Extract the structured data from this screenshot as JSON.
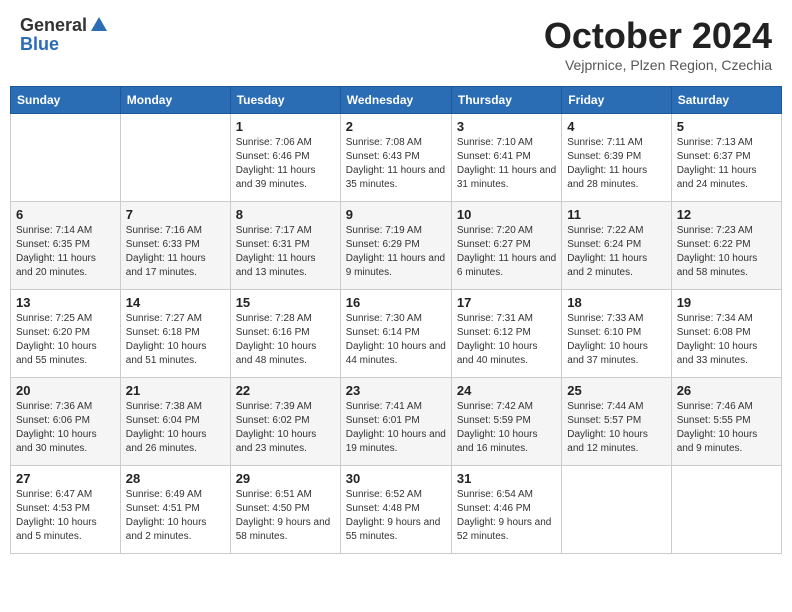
{
  "header": {
    "logo_general": "General",
    "logo_blue": "Blue",
    "month_year": "October 2024",
    "location": "Vejprnice, Plzen Region, Czechia"
  },
  "weekdays": [
    "Sunday",
    "Monday",
    "Tuesday",
    "Wednesday",
    "Thursday",
    "Friday",
    "Saturday"
  ],
  "weeks": [
    [
      {
        "day": "",
        "info": ""
      },
      {
        "day": "",
        "info": ""
      },
      {
        "day": "1",
        "info": "Sunrise: 7:06 AM\nSunset: 6:46 PM\nDaylight: 11 hours and 39 minutes."
      },
      {
        "day": "2",
        "info": "Sunrise: 7:08 AM\nSunset: 6:43 PM\nDaylight: 11 hours and 35 minutes."
      },
      {
        "day": "3",
        "info": "Sunrise: 7:10 AM\nSunset: 6:41 PM\nDaylight: 11 hours and 31 minutes."
      },
      {
        "day": "4",
        "info": "Sunrise: 7:11 AM\nSunset: 6:39 PM\nDaylight: 11 hours and 28 minutes."
      },
      {
        "day": "5",
        "info": "Sunrise: 7:13 AM\nSunset: 6:37 PM\nDaylight: 11 hours and 24 minutes."
      }
    ],
    [
      {
        "day": "6",
        "info": "Sunrise: 7:14 AM\nSunset: 6:35 PM\nDaylight: 11 hours and 20 minutes."
      },
      {
        "day": "7",
        "info": "Sunrise: 7:16 AM\nSunset: 6:33 PM\nDaylight: 11 hours and 17 minutes."
      },
      {
        "day": "8",
        "info": "Sunrise: 7:17 AM\nSunset: 6:31 PM\nDaylight: 11 hours and 13 minutes."
      },
      {
        "day": "9",
        "info": "Sunrise: 7:19 AM\nSunset: 6:29 PM\nDaylight: 11 hours and 9 minutes."
      },
      {
        "day": "10",
        "info": "Sunrise: 7:20 AM\nSunset: 6:27 PM\nDaylight: 11 hours and 6 minutes."
      },
      {
        "day": "11",
        "info": "Sunrise: 7:22 AM\nSunset: 6:24 PM\nDaylight: 11 hours and 2 minutes."
      },
      {
        "day": "12",
        "info": "Sunrise: 7:23 AM\nSunset: 6:22 PM\nDaylight: 10 hours and 58 minutes."
      }
    ],
    [
      {
        "day": "13",
        "info": "Sunrise: 7:25 AM\nSunset: 6:20 PM\nDaylight: 10 hours and 55 minutes."
      },
      {
        "day": "14",
        "info": "Sunrise: 7:27 AM\nSunset: 6:18 PM\nDaylight: 10 hours and 51 minutes."
      },
      {
        "day": "15",
        "info": "Sunrise: 7:28 AM\nSunset: 6:16 PM\nDaylight: 10 hours and 48 minutes."
      },
      {
        "day": "16",
        "info": "Sunrise: 7:30 AM\nSunset: 6:14 PM\nDaylight: 10 hours and 44 minutes."
      },
      {
        "day": "17",
        "info": "Sunrise: 7:31 AM\nSunset: 6:12 PM\nDaylight: 10 hours and 40 minutes."
      },
      {
        "day": "18",
        "info": "Sunrise: 7:33 AM\nSunset: 6:10 PM\nDaylight: 10 hours and 37 minutes."
      },
      {
        "day": "19",
        "info": "Sunrise: 7:34 AM\nSunset: 6:08 PM\nDaylight: 10 hours and 33 minutes."
      }
    ],
    [
      {
        "day": "20",
        "info": "Sunrise: 7:36 AM\nSunset: 6:06 PM\nDaylight: 10 hours and 30 minutes."
      },
      {
        "day": "21",
        "info": "Sunrise: 7:38 AM\nSunset: 6:04 PM\nDaylight: 10 hours and 26 minutes."
      },
      {
        "day": "22",
        "info": "Sunrise: 7:39 AM\nSunset: 6:02 PM\nDaylight: 10 hours and 23 minutes."
      },
      {
        "day": "23",
        "info": "Sunrise: 7:41 AM\nSunset: 6:01 PM\nDaylight: 10 hours and 19 minutes."
      },
      {
        "day": "24",
        "info": "Sunrise: 7:42 AM\nSunset: 5:59 PM\nDaylight: 10 hours and 16 minutes."
      },
      {
        "day": "25",
        "info": "Sunrise: 7:44 AM\nSunset: 5:57 PM\nDaylight: 10 hours and 12 minutes."
      },
      {
        "day": "26",
        "info": "Sunrise: 7:46 AM\nSunset: 5:55 PM\nDaylight: 10 hours and 9 minutes."
      }
    ],
    [
      {
        "day": "27",
        "info": "Sunrise: 6:47 AM\nSunset: 4:53 PM\nDaylight: 10 hours and 5 minutes."
      },
      {
        "day": "28",
        "info": "Sunrise: 6:49 AM\nSunset: 4:51 PM\nDaylight: 10 hours and 2 minutes."
      },
      {
        "day": "29",
        "info": "Sunrise: 6:51 AM\nSunset: 4:50 PM\nDaylight: 9 hours and 58 minutes."
      },
      {
        "day": "30",
        "info": "Sunrise: 6:52 AM\nSunset: 4:48 PM\nDaylight: 9 hours and 55 minutes."
      },
      {
        "day": "31",
        "info": "Sunrise: 6:54 AM\nSunset: 4:46 PM\nDaylight: 9 hours and 52 minutes."
      },
      {
        "day": "",
        "info": ""
      },
      {
        "day": "",
        "info": ""
      }
    ]
  ]
}
